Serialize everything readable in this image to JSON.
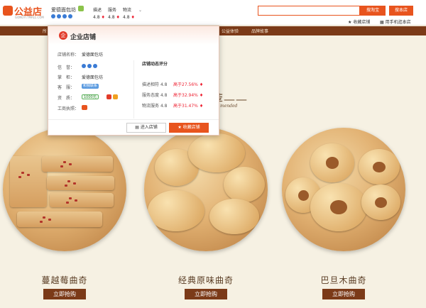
{
  "header": {
    "logo_text": "公益店",
    "logo_sub": "GONGYI.TMALL.COM",
    "shop_name": "爱德面包坊",
    "ratings": [
      {
        "label": "描述",
        "value": "4.8"
      },
      {
        "label": "服务",
        "value": "4.8"
      },
      {
        "label": "物流",
        "value": "4.8"
      }
    ],
    "search_placeholder": "",
    "search_btn": "搜淘宝",
    "store_btn": "搜本店",
    "fav_link": "收藏店铺",
    "phone_link": "用手机逛本店"
  },
  "nav": {
    "items": [
      {
        "label": "所"
      },
      {
        "label": "公益体验"
      },
      {
        "label": "品牌故事"
      }
    ]
  },
  "popup": {
    "title": "企业店铺",
    "shop_label": "店铺名称：",
    "shop_value": "爱德面包坊",
    "credit_label": "信　誉：",
    "seller_label": "掌　柜：",
    "seller_value": "爱德面包坊",
    "service_label": "客　服：",
    "service_tag": "和我联系",
    "quality_label": "资　质：",
    "quality_tag": "1000元",
    "license_label": "工商执照：",
    "score_title": "店铺动态评分",
    "scores": [
      {
        "label": "描述相符",
        "value": "4.8",
        "compare": "高于27.56%"
      },
      {
        "label": "服务态度",
        "value": "4.8",
        "compare": "高于32.94%"
      },
      {
        "label": "物流服务",
        "value": "4.8",
        "compare": "高于31.47%"
      }
    ],
    "enter_btn": "进入店铺",
    "fav_btn": "收藏店铺"
  },
  "section": {
    "title": "荐——",
    "subtitle": "mended"
  },
  "products": [
    {
      "name": "蔓越莓曲奇",
      "buy": "立即抢购"
    },
    {
      "name": "经典原味曲奇",
      "buy": "立即抢购"
    },
    {
      "name": "巴旦木曲奇",
      "buy": "立即抢购"
    }
  ],
  "colors": {
    "accent": "#e8541e",
    "nav": "#7b3a18",
    "bg": "#f6f1e3"
  }
}
